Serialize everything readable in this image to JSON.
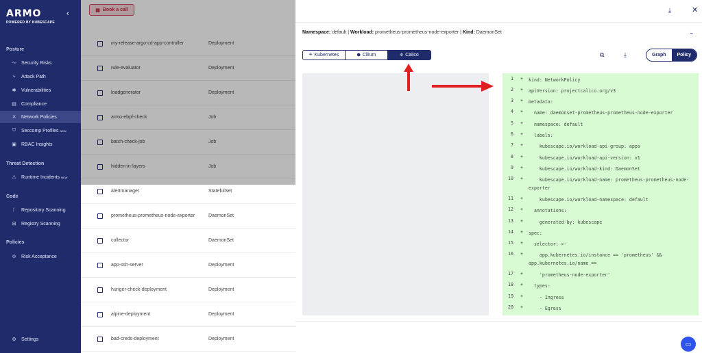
{
  "brand": {
    "name": "ARMO",
    "sub": "POWERED BY KUBESCAPE"
  },
  "sidebar": {
    "sections": [
      {
        "label": "Posture"
      },
      {
        "label": "Threat Detection"
      },
      {
        "label": "Code"
      },
      {
        "label": "Policies"
      }
    ],
    "items": [
      {
        "label": "Security Risks",
        "icon": "trend-icon"
      },
      {
        "label": "Attack Path",
        "icon": "path-icon"
      },
      {
        "label": "Vulnerabilities",
        "icon": "bug-icon"
      },
      {
        "label": "Compliance",
        "icon": "doc-icon"
      },
      {
        "label": "Network Policies",
        "icon": "network-icon"
      },
      {
        "label": "Seccomp Profiles",
        "badge": "NEW",
        "icon": "shield-icon"
      },
      {
        "label": "RBAC Insights",
        "icon": "rbac-icon"
      },
      {
        "label": "Runtime Incidents",
        "badge": "NEW",
        "icon": "warning-icon"
      },
      {
        "label": "Repository Scanning",
        "icon": "branch-icon"
      },
      {
        "label": "Registry Scanning",
        "icon": "registry-icon"
      },
      {
        "label": "Risk Acceptance",
        "icon": "risk-icon"
      },
      {
        "label": "Settings",
        "icon": "gear-icon"
      }
    ]
  },
  "bg": {
    "book_call": "Book a call",
    "rows": [
      {
        "name": "my-release-argo-cd-app-controller",
        "kind": "Deployment"
      },
      {
        "name": "rule-evaluator",
        "kind": "Deployment"
      },
      {
        "name": "loadgenerator",
        "kind": "Deployment"
      },
      {
        "name": "armo-ebpf-check",
        "kind": "Job"
      },
      {
        "name": "batch-check-job",
        "kind": "Job"
      },
      {
        "name": "hidden-in-layers",
        "kind": "Job"
      },
      {
        "name": "alertmanager",
        "kind": "StatefulSet"
      },
      {
        "name": "prometheus-prometheus-node-exporter",
        "kind": "DaemonSet"
      },
      {
        "name": "collector",
        "kind": "DaemonSet"
      },
      {
        "name": "app-ssh-server",
        "kind": "Deployment"
      },
      {
        "name": "hunger-check-deployment",
        "kind": "Deployment"
      },
      {
        "name": "alpine-deployment",
        "kind": "Deployment"
      },
      {
        "name": "bad-creds-deployment",
        "kind": "Deployment"
      }
    ]
  },
  "panel": {
    "meta": {
      "ns_label": "Namespace:",
      "ns": "default",
      "wl_label": "Workload:",
      "wl": "prometheus-prometheus-node-exporter",
      "kind_label": "Kind:",
      "kind": "DaemonSet",
      "sep": "|"
    },
    "tabs": [
      {
        "label": "Kubernetes"
      },
      {
        "label": "Cilium"
      },
      {
        "label": "Calico"
      }
    ],
    "toggle": {
      "graph": "Graph",
      "policy": "Policy"
    },
    "plus": "+",
    "code": [
      {
        "n": "1",
        "t": "kind: NetworkPolicy"
      },
      {
        "n": "2",
        "t": "apiVersion: projectcalico.org/v3"
      },
      {
        "n": "3",
        "t": "metadata:"
      },
      {
        "n": "4",
        "t": "  name: daemonset-prometheus-prometheus-node-exporter"
      },
      {
        "n": "5",
        "t": "  namespace: default"
      },
      {
        "n": "6",
        "t": "  labels:"
      },
      {
        "n": "7",
        "t": "    kubescape.io/workload-api-group: apps"
      },
      {
        "n": "8",
        "t": "    kubescape.io/workload-api-version: v1"
      },
      {
        "n": "9",
        "t": "    kubescape.io/workload-kind: DaemonSet"
      },
      {
        "n": "10",
        "t": "    kubescape.io/workload-name: prometheus-prometheus-node-exporter"
      },
      {
        "n": "11",
        "t": "    kubescape.io/workload-namespace: default"
      },
      {
        "n": "12",
        "t": "  annotations:"
      },
      {
        "n": "13",
        "t": "    generated-by: kubescape"
      },
      {
        "n": "14",
        "t": "spec:"
      },
      {
        "n": "15",
        "t": "  selector: >-"
      },
      {
        "n": "16",
        "t": "    app.kubernetes.io/instance == 'prometheus' && app.kubernetes.io/name =="
      },
      {
        "n": "17",
        "t": "    'prometheus-node-exporter'"
      },
      {
        "n": "18",
        "t": "  types:"
      },
      {
        "n": "19",
        "t": "    - Ingress"
      },
      {
        "n": "20",
        "t": "    - Egress"
      }
    ]
  },
  "colors": {
    "navy": "#1f2b6b",
    "code_bg": "#d9fbd4",
    "arrow": "#e02020"
  }
}
